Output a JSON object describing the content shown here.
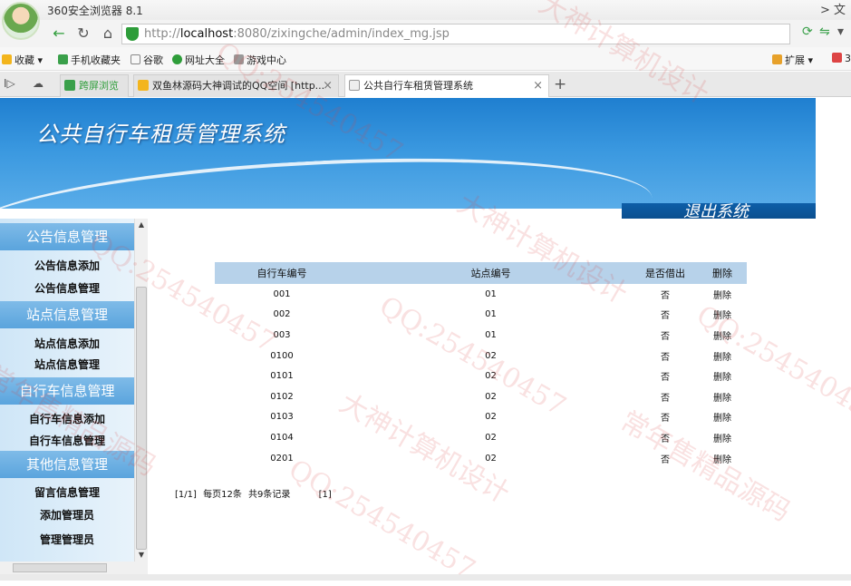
{
  "browser": {
    "window_title": "360安全浏览器 8.1",
    "address": {
      "prefix": "http://",
      "host": "localhost",
      "rest": ":8080/zixingche/admin/index_mg.jsp"
    },
    "bookmarks": [
      "收藏",
      "手机收藏夹",
      "谷歌",
      "网址大全",
      "游戏中心"
    ],
    "bookmark_tools": [
      "扩展"
    ],
    "tabs": [
      {
        "label": "跨屏浏览"
      },
      {
        "label": "双鱼林源码大神调试的QQ空间 [http..."
      },
      {
        "label": "公共自行车租赁管理系统",
        "active": true
      }
    ]
  },
  "banner": {
    "title": "公共自行车租赁管理系统",
    "logout": "退出系统"
  },
  "sidebar": {
    "groups": [
      {
        "heading": "公告信息管理",
        "items": [
          "公告信息添加",
          "公告信息管理"
        ]
      },
      {
        "heading": "站点信息管理",
        "items": [
          "站点信息添加",
          "站点信息管理"
        ]
      },
      {
        "heading": "自行车信息管理",
        "items": [
          "自行车信息添加",
          "自行车信息管理"
        ]
      },
      {
        "heading": "其他信息管理",
        "items": [
          "留言信息管理",
          "添加管理员",
          "管理管理员"
        ]
      }
    ]
  },
  "table": {
    "headers": [
      "自行车编号",
      "站点编号",
      "是否借出",
      "删除"
    ],
    "rows": [
      [
        "001",
        "01",
        "否",
        "删除"
      ],
      [
        "002",
        "01",
        "否",
        "删除"
      ],
      [
        "003",
        "01",
        "否",
        "删除"
      ],
      [
        "0100",
        "02",
        "否",
        "删除"
      ],
      [
        "0101",
        "02",
        "否",
        "删除"
      ],
      [
        "0102",
        "02",
        "否",
        "删除"
      ],
      [
        "0103",
        "02",
        "否",
        "删除"
      ],
      [
        "0104",
        "02",
        "否",
        "删除"
      ],
      [
        "0201",
        "02",
        "否",
        "删除"
      ]
    ]
  },
  "pager": {
    "page_info": "[1/1]",
    "per_page": "每页12条",
    "total": "共9条记录",
    "page_link": "[1]"
  },
  "watermarks": [
    "大神计算机设计",
    "QQ:254540457",
    "常年售精品源码"
  ]
}
